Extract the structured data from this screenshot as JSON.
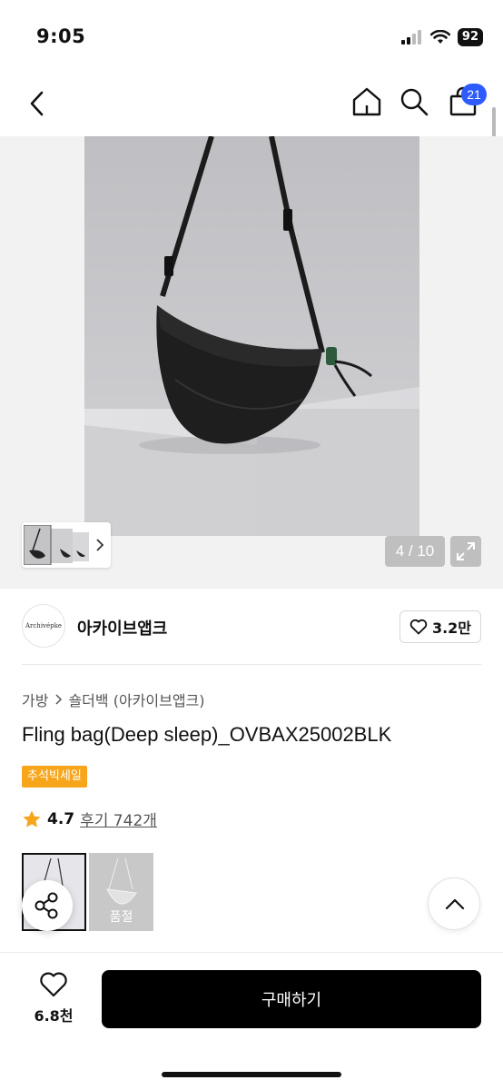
{
  "status_bar": {
    "time": "9:05",
    "battery": "92"
  },
  "nav": {
    "cart_count": "21"
  },
  "gallery": {
    "counter": "4 / 10"
  },
  "brand": {
    "logo_text": "Archivépke",
    "name": "아카이브앱크",
    "likes": "3.2만"
  },
  "breadcrumb": [
    "가방",
    "숄더백 (아카이브앱크)"
  ],
  "product": {
    "title": "Fling bag(Deep sleep)_OVBAX25002BLK",
    "sale_badge": "추석빅세일",
    "rating": "4.7",
    "reviews": "후기 742개"
  },
  "options": [
    {
      "soldout": ""
    },
    {
      "soldout": "품절"
    }
  ],
  "bottom_bar": {
    "wish_count": "6.8천",
    "buy_label": "구매하기"
  },
  "colors": {
    "badge": "#2e5bff",
    "sale": "#f7a51a",
    "star": "#f7a51a",
    "buy_button": "#000000"
  }
}
